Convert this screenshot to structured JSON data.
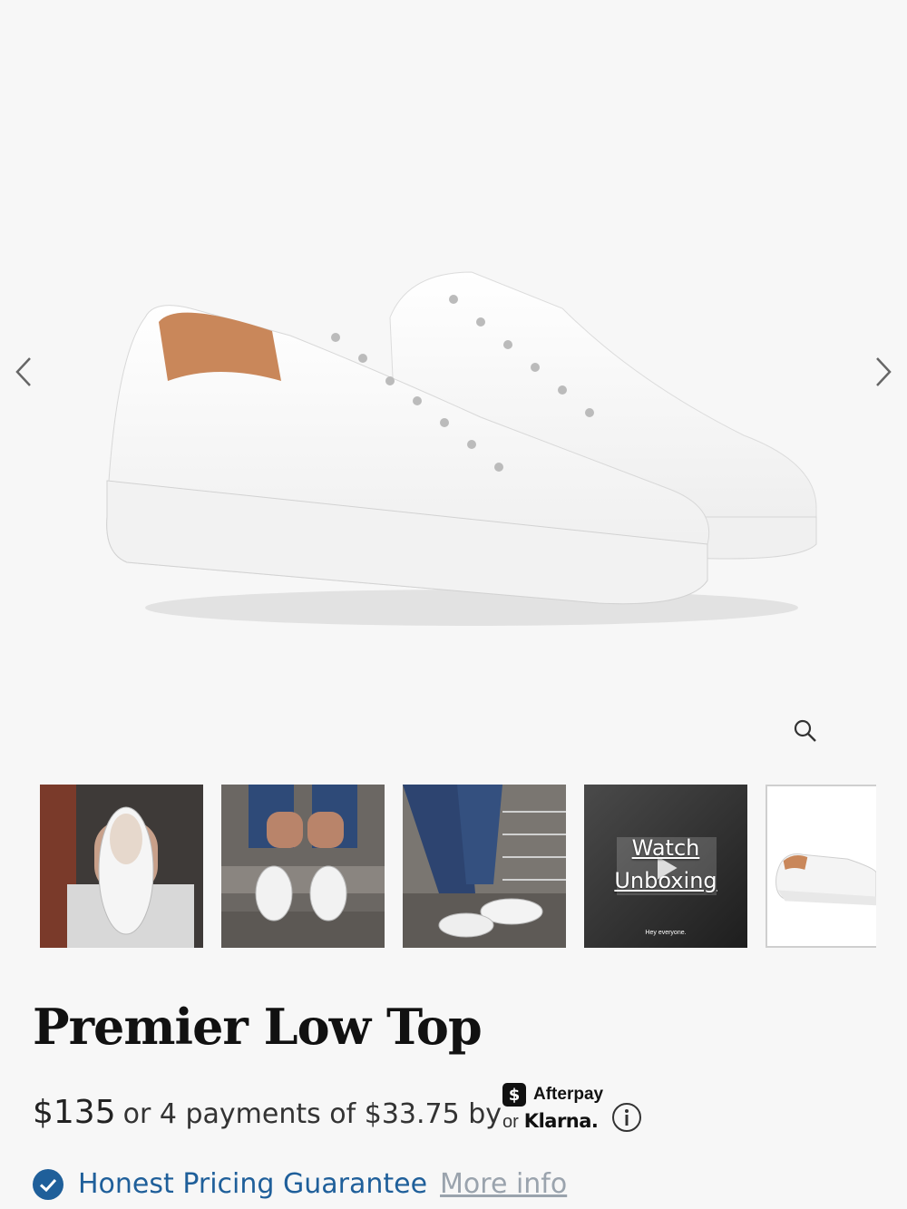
{
  "product": {
    "title": "Premier Low Top",
    "price": "$135",
    "installments_text": "or 4 payments of $33.75 by",
    "afterpay_label": "Afterpay",
    "afterpay_badge": "$",
    "or_label": "or",
    "klarna_label": "Klarna."
  },
  "guarantee": {
    "label": "Honest Pricing Guarantee",
    "link": "More info"
  },
  "gallery": {
    "video_thumb": {
      "line1": "Watch",
      "line2": "Unboxing",
      "caption": "Hey everyone."
    }
  },
  "icons": {
    "prev": "chevron-left-icon",
    "next": "chevron-right-icon",
    "zoom": "magnifier-icon",
    "info": "info-icon",
    "check": "check-circle-icon"
  },
  "colors": {
    "background": "#f7f7f7",
    "guarantee_blue": "#1f5f9a",
    "link_gray": "#9aa3ad"
  }
}
